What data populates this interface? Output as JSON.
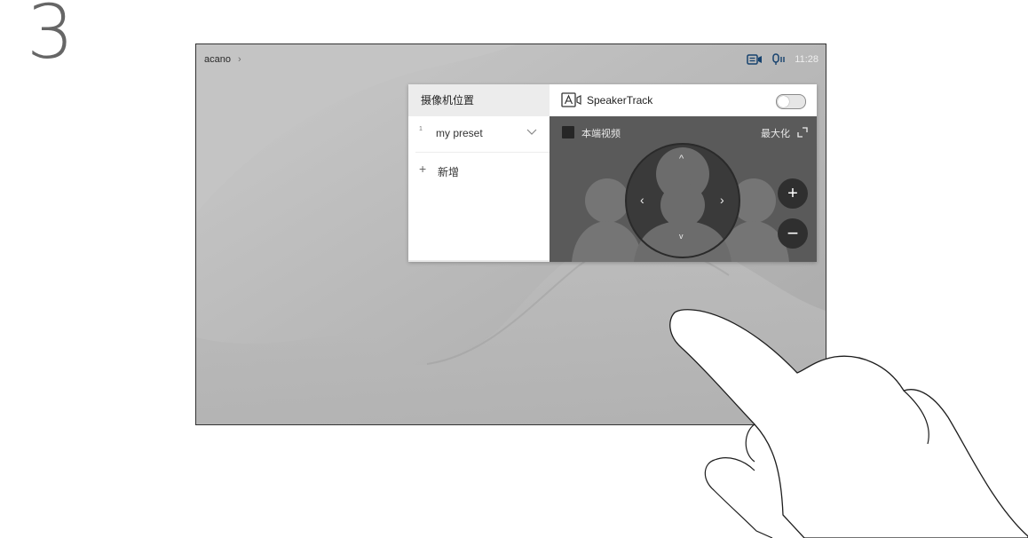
{
  "step_number": "3",
  "topbar": {
    "breadcrumb": "acano",
    "breadcrumb_chevron": "›",
    "time": "11:28",
    "icons": [
      "camera-self-view-icon",
      "microphone-icon"
    ]
  },
  "presets_panel": {
    "title": "摄像机位置",
    "presets": [
      {
        "number": "1",
        "name": "my preset"
      }
    ],
    "add_label": "新增",
    "add_icon": "+"
  },
  "camera_panel": {
    "speakertrack_label": "SpeakerTrack",
    "speakertrack_enabled": false,
    "selfview_label": "本端视频",
    "maximize_label": "最大化",
    "zoom_in": "+",
    "zoom_out": "−",
    "dpad": {
      "up": "^",
      "down": "v",
      "left": "‹",
      "right": "›"
    }
  },
  "colors": {
    "screen_bg": "#b9b9b9",
    "camera_bg": "#5a5a5a",
    "dark_button": "#2f2f2f"
  }
}
